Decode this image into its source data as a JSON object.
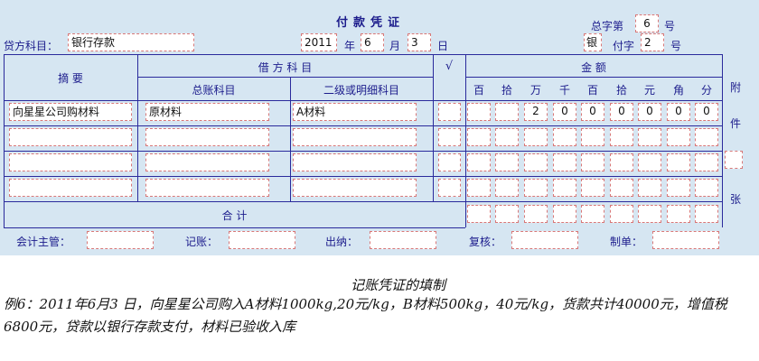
{
  "voucher": {
    "title": "付款凭证",
    "total_no_label": "总字第",
    "total_no_value": "6",
    "hao1": "号",
    "credit_account_label": "贷方科目：",
    "credit_account_value": "银行存款",
    "year": "2011",
    "year_label": "年",
    "month": "6",
    "month_label": "月",
    "day": "3",
    "day_label": "日",
    "bank_char": "银",
    "fu_label": "付字",
    "fu_value": "2",
    "hao2": "号"
  },
  "table": {
    "summary_header": "摘 要",
    "debit_header": "借 方 科 目",
    "general_account_header": "总账科目",
    "sub_account_header": "二级或明细科目",
    "check_header": "√",
    "amount_header": "金 额",
    "digit_headers": [
      "百",
      "拾",
      "万",
      "千",
      "百",
      "拾",
      "元",
      "角",
      "分"
    ],
    "attach_label_1": "附",
    "attach_label_2": "件",
    "attach_label_3": "张",
    "rows": [
      {
        "summary": "向星星公司购材料",
        "general": "原材料",
        "sub": "A材料",
        "digits": [
          "",
          "",
          "2",
          "0",
          "0",
          "0",
          "0",
          "0",
          "0"
        ]
      },
      {
        "summary": "",
        "general": "",
        "sub": "",
        "digits": [
          "",
          "",
          "",
          "",
          "",
          "",
          "",
          "",
          ""
        ]
      },
      {
        "summary": "",
        "general": "",
        "sub": "",
        "digits": [
          "",
          "",
          "",
          "",
          "",
          "",
          "",
          "",
          ""
        ]
      },
      {
        "summary": "",
        "general": "",
        "sub": "",
        "digits": [
          "",
          "",
          "",
          "",
          "",
          "",
          "",
          "",
          ""
        ]
      }
    ],
    "total_label": "合 计"
  },
  "signatures": {
    "supervisor_label": "会计主管：",
    "bookkeeper_label": "记账：",
    "cashier_label": "出纳：",
    "reviewer_label": "复核：",
    "maker_label": "制单："
  },
  "caption": {
    "title": "记账凭证的填制",
    "text": "例6：2011年6月3 日，向星星公司购入A材料1000kg,20元/kg，B材料500kg，40元/kg，货款共计40000元，增值税6800元，贷款以银行存款支付，材料已验收入库"
  }
}
